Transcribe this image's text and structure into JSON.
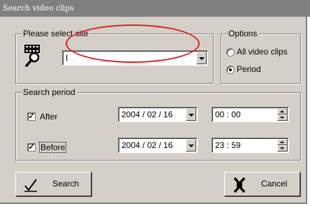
{
  "window": {
    "title": "Search video clips"
  },
  "site": {
    "legend": "Please select site",
    "selected": "I",
    "icon": "search-camera-icon"
  },
  "options": {
    "legend": "Options",
    "radios": [
      {
        "label": "All video clips",
        "checked": false
      },
      {
        "label": "Period",
        "checked": true
      }
    ]
  },
  "period": {
    "legend": "Search period",
    "after": {
      "label": "After",
      "checked": true,
      "date": "2004 / 02 / 16",
      "time": "00 : 00"
    },
    "before": {
      "label": "Before",
      "checked": true,
      "date": "2004 / 02 / 16",
      "time": "23 : 59"
    }
  },
  "buttons": {
    "search_label": "Search",
    "cancel_label": "Cancel"
  },
  "annotation": {
    "color": "#e02020",
    "shape": "red ellipse highlighting site dropdown"
  }
}
